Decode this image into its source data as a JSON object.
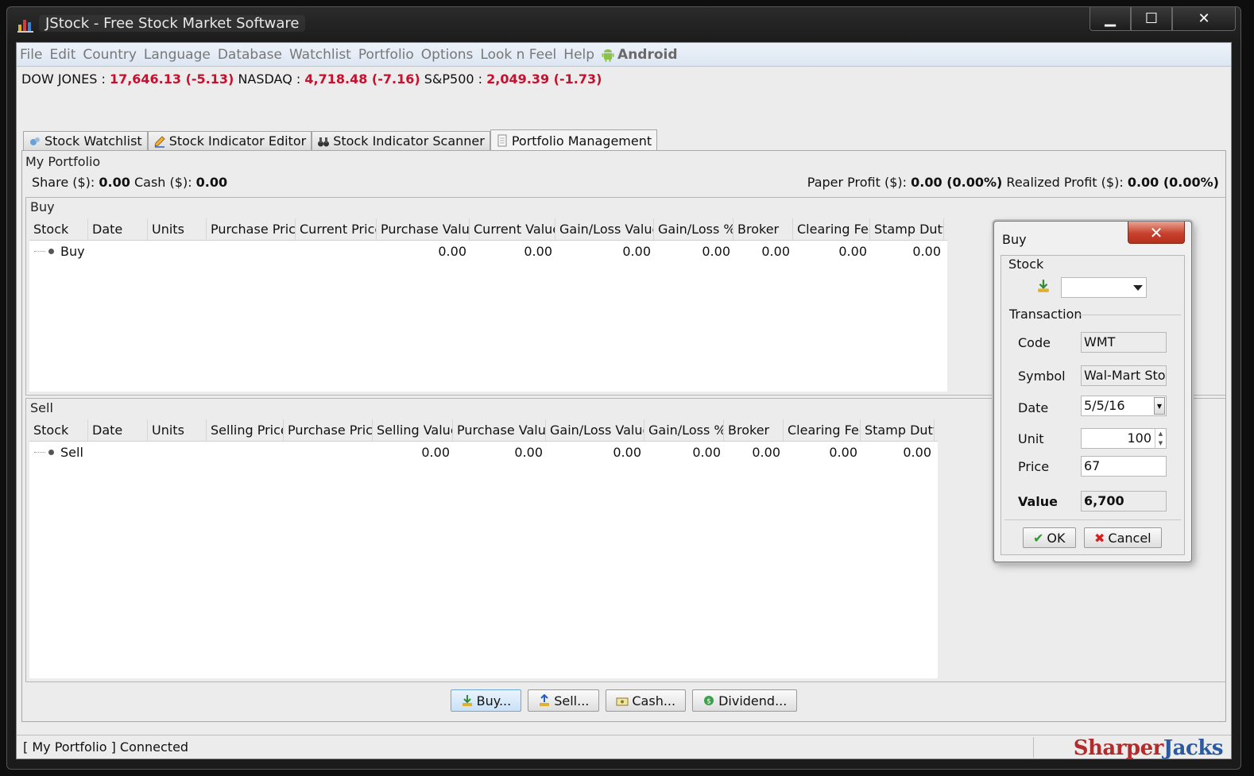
{
  "window": {
    "title": "JStock - Free Stock Market Software",
    "minimize_label": "▁",
    "maximize_label": "☐",
    "close_label": "✕"
  },
  "menu": [
    "File",
    "Edit",
    "Country",
    "Language",
    "Database",
    "Watchlist",
    "Portfolio",
    "Options",
    "Look n Feel",
    "Help"
  ],
  "menu_android": "Android",
  "indices": {
    "dow_label": "DOW JONES :",
    "dow_value": "17,646.13 (-5.13)",
    "nasdaq_label": "NASDAQ :",
    "nasdaq_value": "4,718.48 (-7.16)",
    "sp_label": "S&P500 :",
    "sp_value": "2,049.39 (-1.73)"
  },
  "tabs": [
    {
      "label": "Stock Watchlist",
      "icon": "watchlist-icon"
    },
    {
      "label": "Stock Indicator Editor",
      "icon": "pencil-icon"
    },
    {
      "label": "Stock Indicator Scanner",
      "icon": "binoculars-icon"
    },
    {
      "label": "Portfolio Management",
      "icon": "document-icon"
    }
  ],
  "portfolio": {
    "title": "My Portfolio",
    "share_label": "Share ($):",
    "share_value": "0.00",
    "cash_label": "Cash ($):",
    "cash_value": "0.00",
    "paper_label": "Paper Profit ($):",
    "paper_value": "0.00 (0.00%)",
    "realized_label": "Realized Profit ($):",
    "realized_value": "0.00 (0.00%)"
  },
  "buy_table": {
    "title": "Buy",
    "headers": [
      "Stock",
      "Date",
      "Units",
      "Purchase Price",
      "Current Price",
      "Purchase Value",
      "Current Value",
      "Gain/Loss Value",
      "Gain/Loss %",
      "Broker",
      "Clearing Fee",
      "Stamp Duty"
    ],
    "row": [
      "Buy",
      "",
      "",
      "",
      "",
      "0.00",
      "0.00",
      "0.00",
      "0.00",
      "0.00",
      "0.00",
      "0.00"
    ]
  },
  "sell_table": {
    "title": "Sell",
    "headers": [
      "Stock",
      "Date",
      "Units",
      "Selling Price",
      "Purchase Price",
      "Selling Value",
      "Purchase Value",
      "Gain/Loss Value",
      "Gain/Loss %",
      "Broker",
      "Clearing Fee",
      "Stamp Duty"
    ],
    "row": [
      "Sell",
      "",
      "",
      "",
      "",
      "0.00",
      "0.00",
      "0.00",
      "0.00",
      "0.00",
      "0.00",
      "0.00"
    ]
  },
  "buttons": {
    "buy": "Buy...",
    "sell": "Sell...",
    "cash": "Cash...",
    "dividend": "Dividend..."
  },
  "status": {
    "text": "[ My Portfolio ] Connected",
    "brand_a": "Sharper",
    "brand_b": "Jacks"
  },
  "dialog": {
    "title": "Buy",
    "close_label": "✕",
    "stock_section": "Stock",
    "stock_combo_value": "",
    "transaction_section": "Transaction",
    "code_label": "Code",
    "code_value": "WMT",
    "symbol_label": "Symbol",
    "symbol_value": "Wal-Mart Stores",
    "date_label": "Date",
    "date_value": "5/5/16",
    "unit_label": "Unit",
    "unit_value": "100",
    "price_label": "Price",
    "price_value": "67",
    "value_label": "Value",
    "value_value": "6,700",
    "ok_label": "OK",
    "cancel_label": "Cancel"
  },
  "colors": {
    "index_value": "#c8102e",
    "ok_check": "#2e9a2e",
    "cancel_x": "#d32020"
  }
}
